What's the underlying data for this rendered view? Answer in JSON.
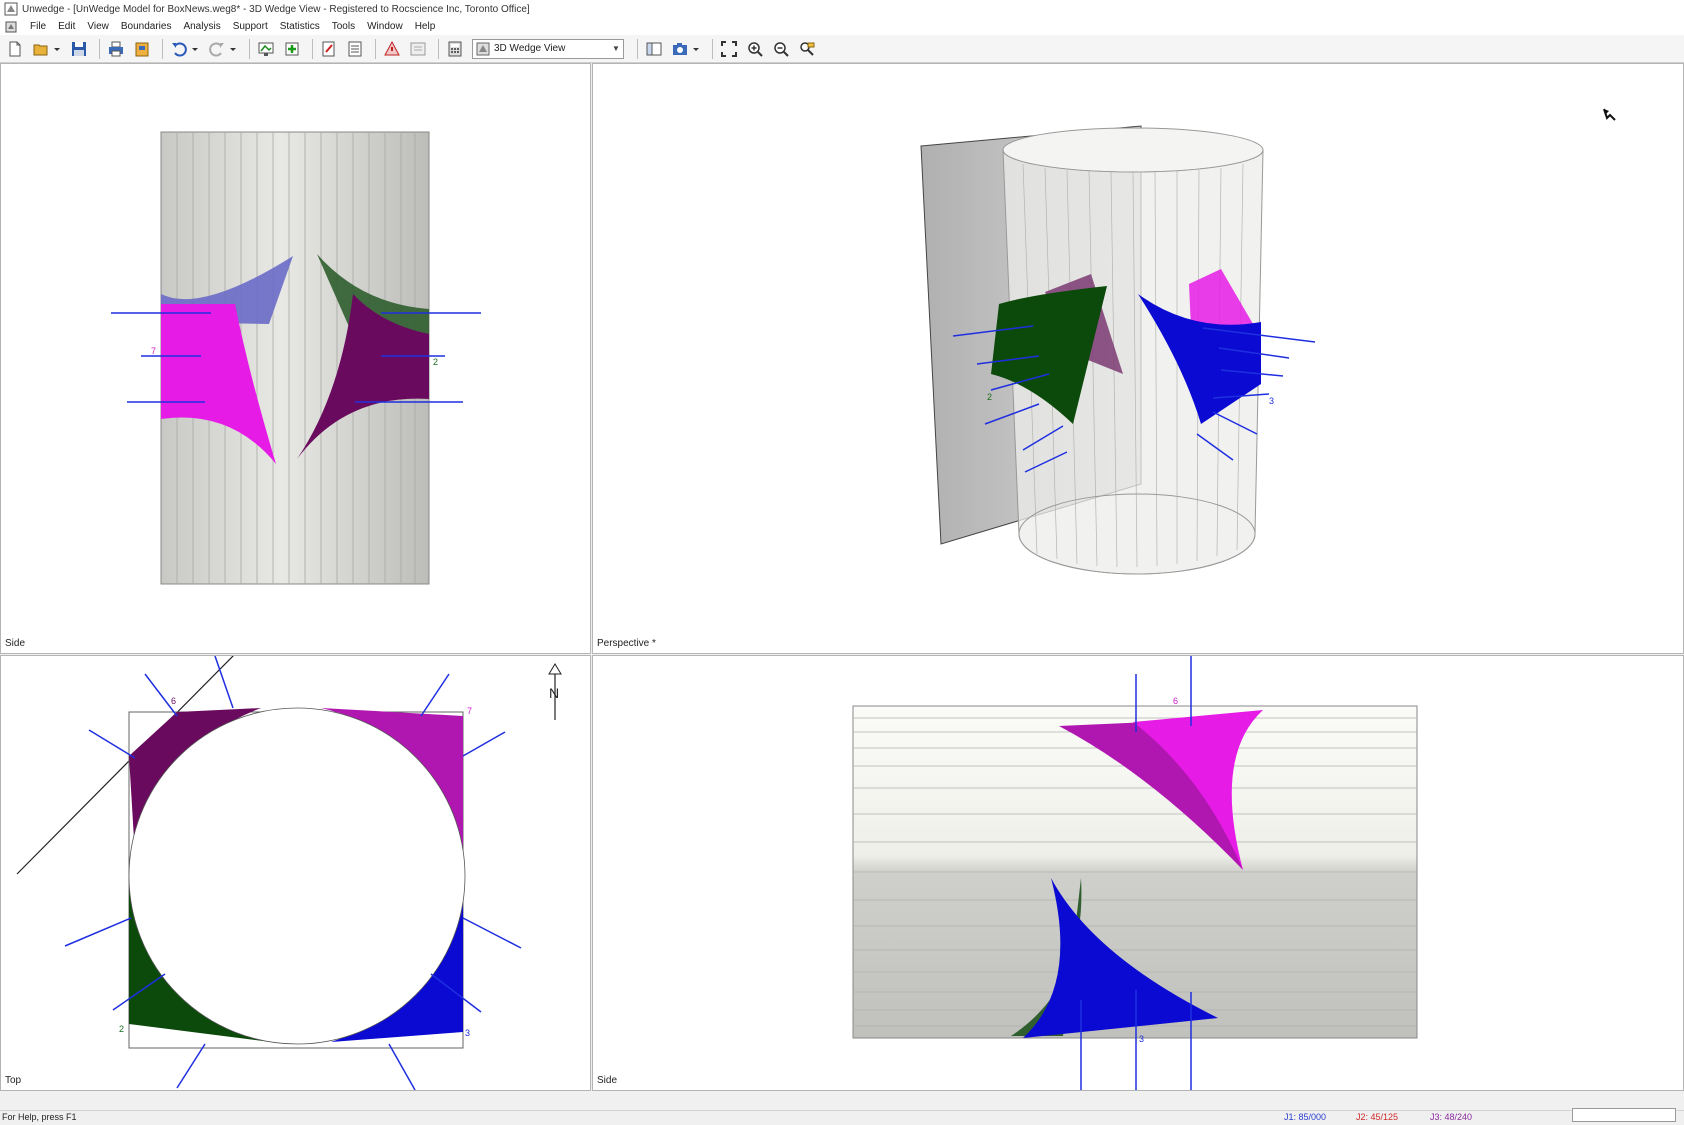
{
  "window": {
    "title": "Unwedge - [UnWedge Model for BoxNews.weg8* - 3D Wedge View - Registered to Rocscience Inc, Toronto Office]"
  },
  "menu": [
    "File",
    "Edit",
    "View",
    "Boundaries",
    "Analysis",
    "Support",
    "Statistics",
    "Tools",
    "Window",
    "Help"
  ],
  "toolbar": {
    "view_select": "3D Wedge View",
    "icons": [
      "new-file-icon",
      "open-folder-icon",
      "save-icon",
      "print-icon",
      "export-icon",
      "undo-icon",
      "redo-icon",
      "display-options-icon",
      "add-support-icon",
      "edit-icon",
      "report-icon",
      "compute-icon",
      "info-viewer-icon",
      "sidebar-icon",
      "camera-icon",
      "zoom-extents-icon",
      "zoom-in-icon",
      "zoom-out-icon",
      "zoom-window-icon"
    ]
  },
  "viewports": {
    "top_left": {
      "label": "Side"
    },
    "top_right": {
      "label": "Perspective *"
    },
    "bottom_left": {
      "label": "Top",
      "north": "N"
    },
    "bottom_right": {
      "label": "Side"
    }
  },
  "wedge_labels": {
    "left": "7",
    "right": "2",
    "top_left": "6",
    "top_right": "7",
    "bottom_left": "2",
    "bottom_right": "3",
    "perspective_left": "2",
    "perspective_right": "3",
    "side_top": "6",
    "side_bottom": "3"
  },
  "colors": {
    "magenta": "#e61ce6",
    "purple": "#6a0a5e",
    "dark_green": "#0c4a0c",
    "blue": "#0a0ad2",
    "slate": "#6a6ac8",
    "bolt": "#1f2fe0"
  },
  "status": {
    "help": "For Help, press F1",
    "j1": "J1: 85/000",
    "j2": "J2: 45/125",
    "j3": "J3: 48/240"
  }
}
